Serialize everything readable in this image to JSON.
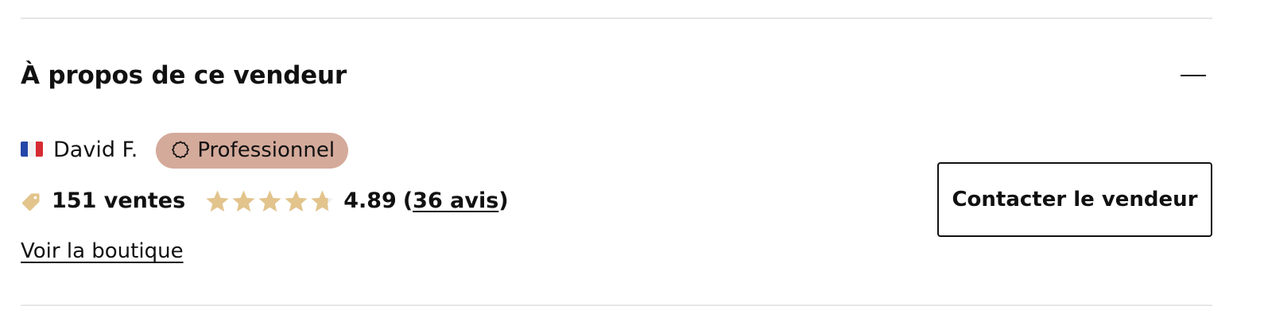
{
  "section": {
    "title": "À propos de ce vendeur"
  },
  "seller": {
    "country_flag": "france-flag",
    "name": "David F.",
    "badge_label": "Professionnel",
    "badge_color": "#d4aa9b"
  },
  "stats": {
    "sales_label": "151 ventes",
    "rating_value": "4.89",
    "rating_fraction": 0.978,
    "star_count": 5,
    "star_color": "#e2c48c",
    "star_empty_color": "#efefef",
    "tag_color": "#e2c48c",
    "open_paren": "(",
    "reviews_label": "36 avis",
    "close_paren": ")"
  },
  "links": {
    "shop_label": "Voir la boutique"
  },
  "actions": {
    "contact_label": "Contacter le vendeur"
  }
}
